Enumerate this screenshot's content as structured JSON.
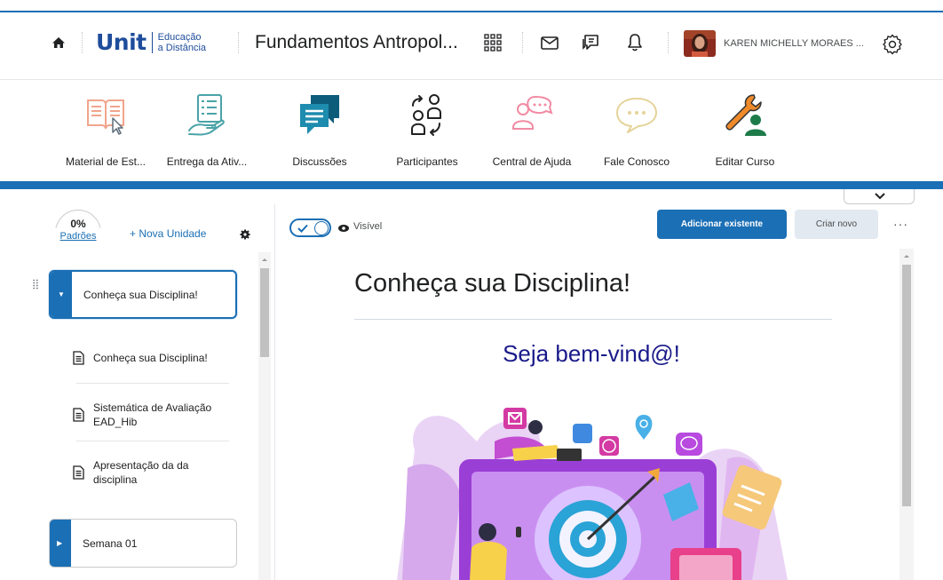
{
  "header": {
    "logo_word": "Unit",
    "logo_sub_1": "Educação",
    "logo_sub_2": "a Distância",
    "course_title": "Fundamentos Antropol...",
    "user_name": "KAREN MICHELLY MORAES ..."
  },
  "tools": [
    {
      "label": "Material de Est...",
      "icon": "book-icon"
    },
    {
      "label": "Entrega da Ativ...",
      "icon": "checklist-hand-icon"
    },
    {
      "label": "Discussões",
      "icon": "chat-bubbles-icon"
    },
    {
      "label": "Participantes",
      "icon": "participants-icon"
    },
    {
      "label": "Central de Ajuda",
      "icon": "help-chat-icon"
    },
    {
      "label": "Fale Conosco",
      "icon": "speech-bubble-icon"
    },
    {
      "label": "Editar Curso",
      "icon": "wrench-user-icon"
    }
  ],
  "sidebar": {
    "progress_value": "0%",
    "progress_label": "Padrões",
    "new_unit_label": "+ Nova Unidade",
    "units": [
      {
        "label": "Conheça sua Disciplina!",
        "expanded": true,
        "selected": true
      },
      {
        "label": "Semana 01",
        "expanded": false,
        "selected": false
      }
    ],
    "topics": [
      {
        "label_lines": [
          "Conheça sua Disciplina!"
        ]
      },
      {
        "label_lines": [
          "Sistemática de Avaliação",
          "EAD_Hib"
        ]
      },
      {
        "label_lines": [
          "Apresentação da da",
          "disciplina"
        ]
      }
    ]
  },
  "toolbar": {
    "visibility_label": "Visível",
    "visible": true,
    "add_existing_label": "Adicionar existente",
    "create_new_label": "Criar novo",
    "more_label": "···"
  },
  "content": {
    "heading": "Conheça sua Disciplina!",
    "welcome": "Seja bem-vind@!"
  },
  "colors": {
    "brand_blue": "#1a6fb5",
    "logo_blue": "#1e4d9b",
    "welcome_text": "#1a1a8a"
  }
}
